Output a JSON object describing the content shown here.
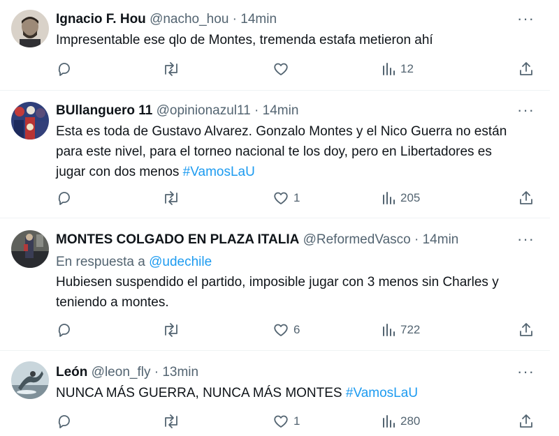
{
  "tweets": [
    {
      "name": "Ignacio F. Hou",
      "handle": "@nacho_hou",
      "sep": "·",
      "time": "14min",
      "reply_to_prefix": "",
      "reply_to_handle": "",
      "text_lines": [
        "Impresentable ese qlo de Montes, tremenda estafa metieron ahí"
      ],
      "hashtag": "",
      "likes": "",
      "views": "12",
      "avatar_colors": [
        "#9d8a78",
        "#3a3129"
      ]
    },
    {
      "name": "BUllanguero 11",
      "handle": "@opinionazul11",
      "sep": "·",
      "time": "14min",
      "reply_to_prefix": "",
      "reply_to_handle": "",
      "text_lines": [
        "Esta es toda de Gustavo Alvarez. Gonzalo Montes y el Nico Guerra no están",
        "para este nivel, para el torneo nacional te los doy, pero en Libertadores es",
        "jugar con dos menos "
      ],
      "hashtag": "#VamosLaU",
      "likes": "1",
      "views": "205",
      "avatar_colors": [
        "#5a4d7a",
        "#c23b3b"
      ]
    },
    {
      "name": "MONTES COLGADO EN PLAZA ITALIA",
      "handle": "@ReformedVasco",
      "sep": "·",
      "time": "14min",
      "reply_to_prefix": "En respuesta a ",
      "reply_to_handle": "@udechile",
      "text_lines": [
        "Hubiesen suspendido el partido, imposible jugar con 3 menos sin Charles y",
        "teniendo a montes."
      ],
      "hashtag": "",
      "likes": "6",
      "views": "722",
      "avatar_colors": [
        "#6e6f6a",
        "#2a2c30"
      ]
    },
    {
      "name": "León",
      "handle": "@leon_fly",
      "sep": "·",
      "time": "13min",
      "reply_to_prefix": "",
      "reply_to_handle": "",
      "text_lines": [
        "NUNCA MÁS GUERRA, NUNCA MÁS MONTES "
      ],
      "hashtag": "#VamosLaU",
      "likes": "1",
      "views": "280",
      "avatar_colors": [
        "#8fa3b0",
        "#46555c"
      ]
    }
  ],
  "icons": {
    "reply": "reply-icon",
    "retweet": "retweet-icon",
    "like": "like-icon",
    "views": "views-icon",
    "share": "share-icon",
    "more": "more-icon"
  },
  "colors": {
    "link": "#1d9bf0",
    "muted": "#536471",
    "text": "#0f1419"
  },
  "more_glyph": "···"
}
